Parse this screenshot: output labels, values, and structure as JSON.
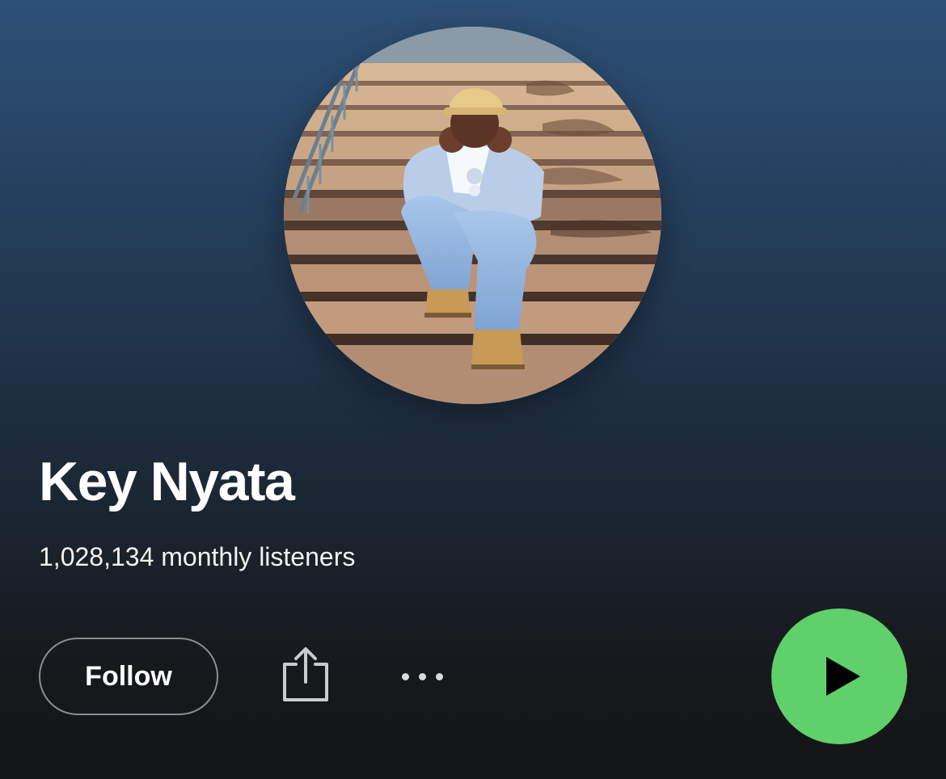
{
  "artist": {
    "name": "Key Nyata",
    "monthly_listeners": "1,028,134 monthly listeners"
  },
  "actions": {
    "follow_label": "Follow",
    "share_icon": "share-icon",
    "more_icon": "more-options-icon",
    "play_icon": "play-icon"
  },
  "colors": {
    "play_button": "#5fd06a",
    "background_top": "#2d5077",
    "background_bottom": "#131416"
  }
}
